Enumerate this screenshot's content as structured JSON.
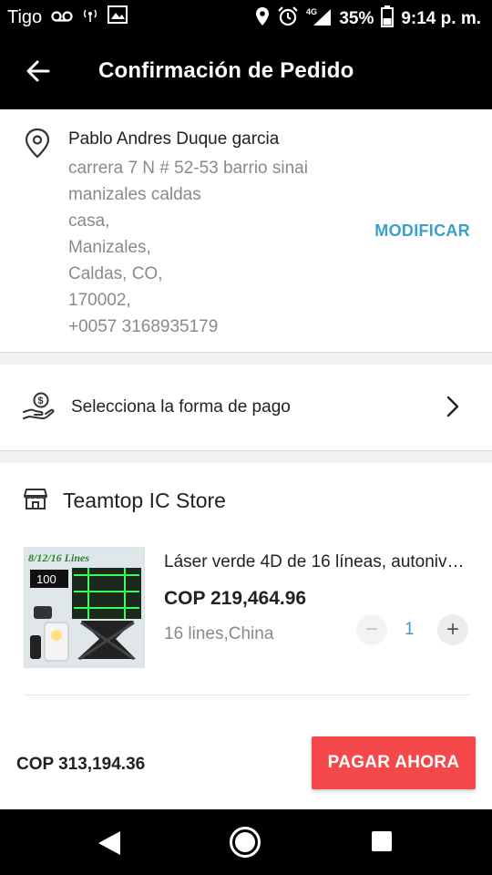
{
  "status_bar": {
    "carrier": "Tigo",
    "battery": "35%",
    "time": "9:14 p. m.",
    "network": "4G",
    "icons": [
      "voicemail-icon",
      "hotspot-icon",
      "image-icon",
      "location-icon",
      "alarm-icon",
      "signal-icon",
      "battery-icon"
    ]
  },
  "app_bar": {
    "title": "Confirmación de Pedido",
    "back_icon": "arrow-left-icon"
  },
  "address": {
    "name": "Pablo Andres Duque garcia",
    "lines": [
      "carrera 7 N # 52-53 barrio sinai",
      "manizales caldas",
      "casa,",
      "Manizales,",
      "Caldas, CO,",
      "170002,",
      "+0057 3168935179"
    ],
    "modify_label": "MODIFICAR",
    "icon": "location-pin-icon"
  },
  "payment": {
    "label": "Selecciona la forma de pago",
    "icon": "hand-money-icon",
    "chevron": "chevron-right-icon"
  },
  "store": {
    "name": "Teamtop IC Store",
    "icon": "store-icon"
  },
  "product": {
    "title": "Láser verde 4D de 16 líneas, autonivelante",
    "price": "COP 219,464.96",
    "variant": "16 lines,China",
    "quantity": "1",
    "minus_label": "−",
    "plus_label": "+",
    "image_texts": {
      "banner": "8/12/16 Lines",
      "display": "100"
    }
  },
  "checkout": {
    "total": "COP 313,194.36",
    "button_label": "PAGAR AHORA"
  },
  "colors": {
    "accent": "#3aa0c7",
    "pay_button": "#f5484a",
    "bars": "#000000",
    "secondary_text": "#8a8a8a"
  }
}
